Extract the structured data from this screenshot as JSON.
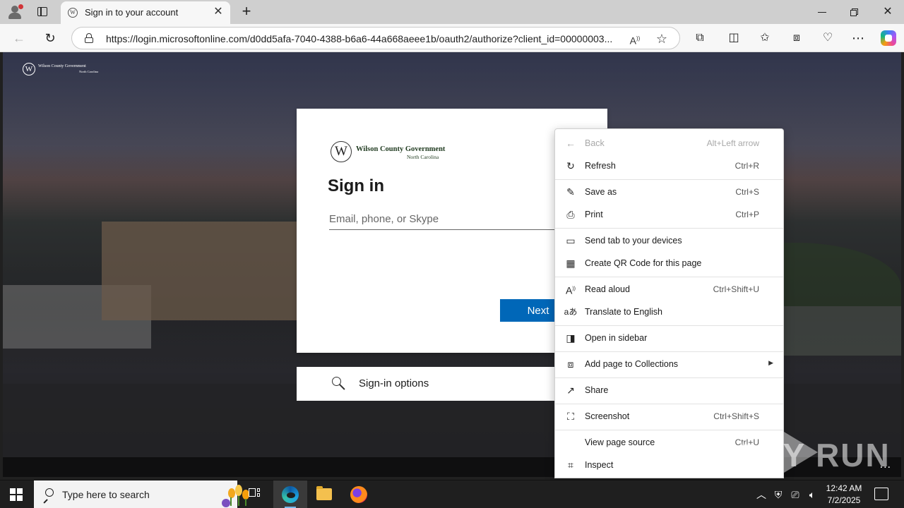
{
  "browser": {
    "tab_title": "Sign in to your account",
    "tab_favicon_letter": "W",
    "new_tab_symbol": "+",
    "url": "https://login.microsoftonline.com/d0dd5afa-7040-4388-b6a6-44a668aeee1b/oauth2/authorize?client_id=00000003...",
    "icons": [
      "profile-icon",
      "tab-actions-icon",
      "back-icon",
      "refresh-icon",
      "lock-icon",
      "read-aloud-icon",
      "favorite-star-icon",
      "extensions-icon",
      "split-screen-icon",
      "favorites-icon",
      "collections-icon",
      "browser-essentials-icon",
      "more-icon",
      "copilot-icon"
    ]
  },
  "page": {
    "corner_logo": {
      "letter": "W",
      "name": "Wilson County Government",
      "region": "North Carolina"
    },
    "org_logo": {
      "letter": "W",
      "name": "Wilson County Government",
      "region": "North Carolina"
    },
    "title": "Sign in",
    "email_placeholder": "Email, phone, or Skype",
    "next_label": "Next",
    "signin_options_label": "Sign-in options",
    "more_symbol": "..."
  },
  "context_menu": {
    "items": [
      {
        "label": "Back",
        "shortcut": "Alt+Left arrow",
        "icon": "back-arrow-icon",
        "disabled": true
      },
      {
        "label": "Refresh",
        "shortcut": "Ctrl+R",
        "icon": "refresh-icon",
        "disabled": false
      },
      {
        "label": "Save as",
        "shortcut": "Ctrl+S",
        "icon": "save-as-icon",
        "disabled": false
      },
      {
        "label": "Print",
        "shortcut": "Ctrl+P",
        "icon": "print-icon",
        "disabled": false
      },
      {
        "label": "Send tab to your devices",
        "shortcut": "",
        "icon": "send-tab-icon",
        "disabled": false
      },
      {
        "label": "Create QR Code for this page",
        "shortcut": "",
        "icon": "qr-code-icon",
        "disabled": false
      },
      {
        "label": "Read aloud",
        "shortcut": "Ctrl+Shift+U",
        "icon": "read-aloud-icon",
        "disabled": false
      },
      {
        "label": "Translate to English",
        "shortcut": "",
        "icon": "translate-icon",
        "disabled": false
      },
      {
        "label": "Open in sidebar",
        "shortcut": "",
        "icon": "sidebar-icon",
        "disabled": false
      },
      {
        "label": "Add page to Collections",
        "shortcut": "",
        "icon": "collections-icon",
        "disabled": false,
        "submenu": true
      },
      {
        "label": "Share",
        "shortcut": "",
        "icon": "share-icon",
        "disabled": false
      },
      {
        "label": "Screenshot",
        "shortcut": "Ctrl+Shift+S",
        "icon": "screenshot-icon",
        "disabled": false
      },
      {
        "label": "View page source",
        "shortcut": "Ctrl+U",
        "icon": "",
        "disabled": false
      },
      {
        "label": "Inspect",
        "shortcut": "",
        "icon": "inspect-icon",
        "disabled": false
      }
    ]
  },
  "watermark": "ANY RUN",
  "taskbar": {
    "search_placeholder": "Type here to search",
    "time": "12:42 AM",
    "date": "7/2/2025",
    "icons": [
      "windows-start-icon",
      "search-icon",
      "task-view-icon",
      "edge-icon",
      "file-explorer-icon",
      "firefox-icon",
      "tray-chevron-icon",
      "network-icon",
      "volume-icon",
      "notification-icon"
    ]
  }
}
